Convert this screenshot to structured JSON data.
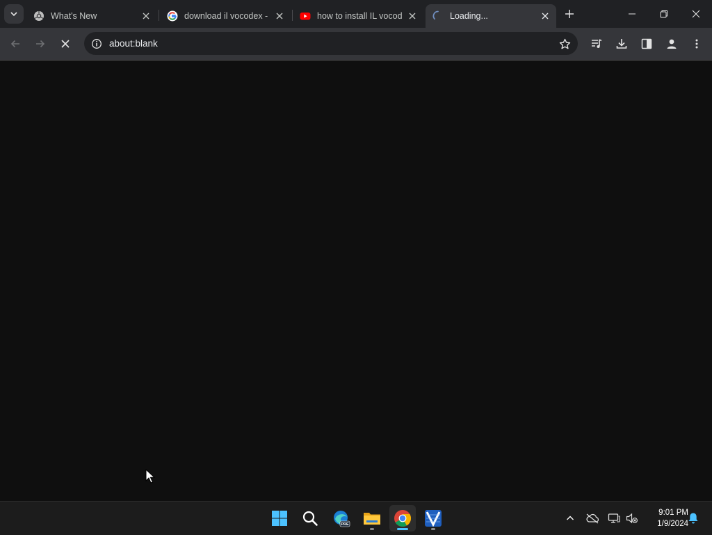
{
  "browser": {
    "tabs": [
      {
        "title": "What's New",
        "favicon": "chrome-icon",
        "active": false
      },
      {
        "title": "download il vocodex - ",
        "favicon": "google-icon",
        "active": false
      },
      {
        "title": "how to install IL vocod",
        "favicon": "youtube-icon",
        "active": false
      },
      {
        "title": "Loading...",
        "favicon": "loading-spinner-icon",
        "active": true
      }
    ],
    "address": "about:blank"
  },
  "taskbar": {
    "apps": [
      "windows-start-icon",
      "search-icon",
      "edge-preview-icon",
      "file-explorer-icon",
      "chrome-icon",
      "video-editor-icon"
    ],
    "clock": {
      "time": "9:01 PM",
      "date": "1/9/2024"
    }
  },
  "colors": {
    "tabstrip": "#202124",
    "toolbar": "#35363a",
    "content": "#0f0f0f",
    "taskbar": "#1c1c1c",
    "accent": "#4cc2ff"
  }
}
